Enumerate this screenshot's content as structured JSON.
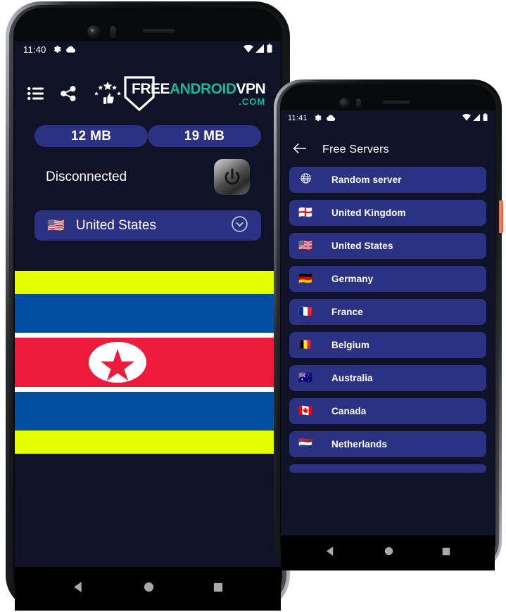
{
  "app": {
    "brand": {
      "part1": "FREE",
      "part2": "ANDROID",
      "part3": "VPN",
      "part4": ".COM",
      "color_white": "#ffffff",
      "color_teal": "#16b89a"
    },
    "accent_button": "#2c3283",
    "screen_bg": "#101228"
  },
  "phone1": {
    "status": {
      "time": "11:40",
      "gear_icon": "gear-icon",
      "cloud_icon": "cloud-icon",
      "wifi_icon": "wifi-icon",
      "signal_icon": "signal-icon",
      "battery_icon": "battery-icon"
    },
    "toolbar": {
      "menu_icon": "list-menu-icon",
      "share_icon": "share-icon",
      "rate_icon": "rate-thumbsup-stars-icon"
    },
    "stats": {
      "download_label": "12 MB",
      "upload_label": "19 MB"
    },
    "connection": {
      "status_text": "Disconnected",
      "power_icon": "power-button-icon"
    },
    "country_selector": {
      "flag": "🇺🇸",
      "name": "United States",
      "chevron_icon": "chevron-down-circle-icon"
    },
    "banner": {
      "flag_name": "north-korea-flag",
      "band_color": "#e6ff00",
      "blue": "#024fa2",
      "red": "#ed1a3b",
      "white": "#ffffff"
    },
    "navbar": {
      "back_icon": "nav-back-icon",
      "home_icon": "nav-home-icon",
      "recents_icon": "nav-recents-icon"
    }
  },
  "phone2": {
    "status": {
      "time": "11:41",
      "gear_icon": "gear-icon",
      "cloud_icon": "cloud-icon",
      "wifi_icon": "wifi-icon",
      "signal_icon": "signal-icon",
      "battery_icon": "battery-icon"
    },
    "header": {
      "back_icon": "back-arrow-icon",
      "title": "Free Servers"
    },
    "servers": [
      {
        "flag": "🌐",
        "name": "Random server",
        "icon": "globe-icon"
      },
      {
        "flag": "🏴󠁧󠁢󠁥󠁮󠁧󠁿",
        "name": "United Kingdom",
        "icon": "flag-uk-icon"
      },
      {
        "flag": "🇺🇸",
        "name": "United States",
        "icon": "flag-us-icon"
      },
      {
        "flag": "🇩🇪",
        "name": "Germany",
        "icon": "flag-de-icon"
      },
      {
        "flag": "🇫🇷",
        "name": "France",
        "icon": "flag-fr-icon"
      },
      {
        "flag": "🇧🇪",
        "name": "Belgium",
        "icon": "flag-be-icon"
      },
      {
        "flag": "🇦🇺",
        "name": "Australia",
        "icon": "flag-au-icon"
      },
      {
        "flag": "🇨🇦",
        "name": "Canada",
        "icon": "flag-ca-icon"
      },
      {
        "flag": "🇳🇱",
        "name": "Netherlands",
        "icon": "flag-nl-icon"
      }
    ],
    "navbar": {
      "back_icon": "nav-back-icon",
      "home_icon": "nav-home-icon",
      "recents_icon": "nav-recents-icon"
    },
    "side_button": "volume-side-button"
  }
}
